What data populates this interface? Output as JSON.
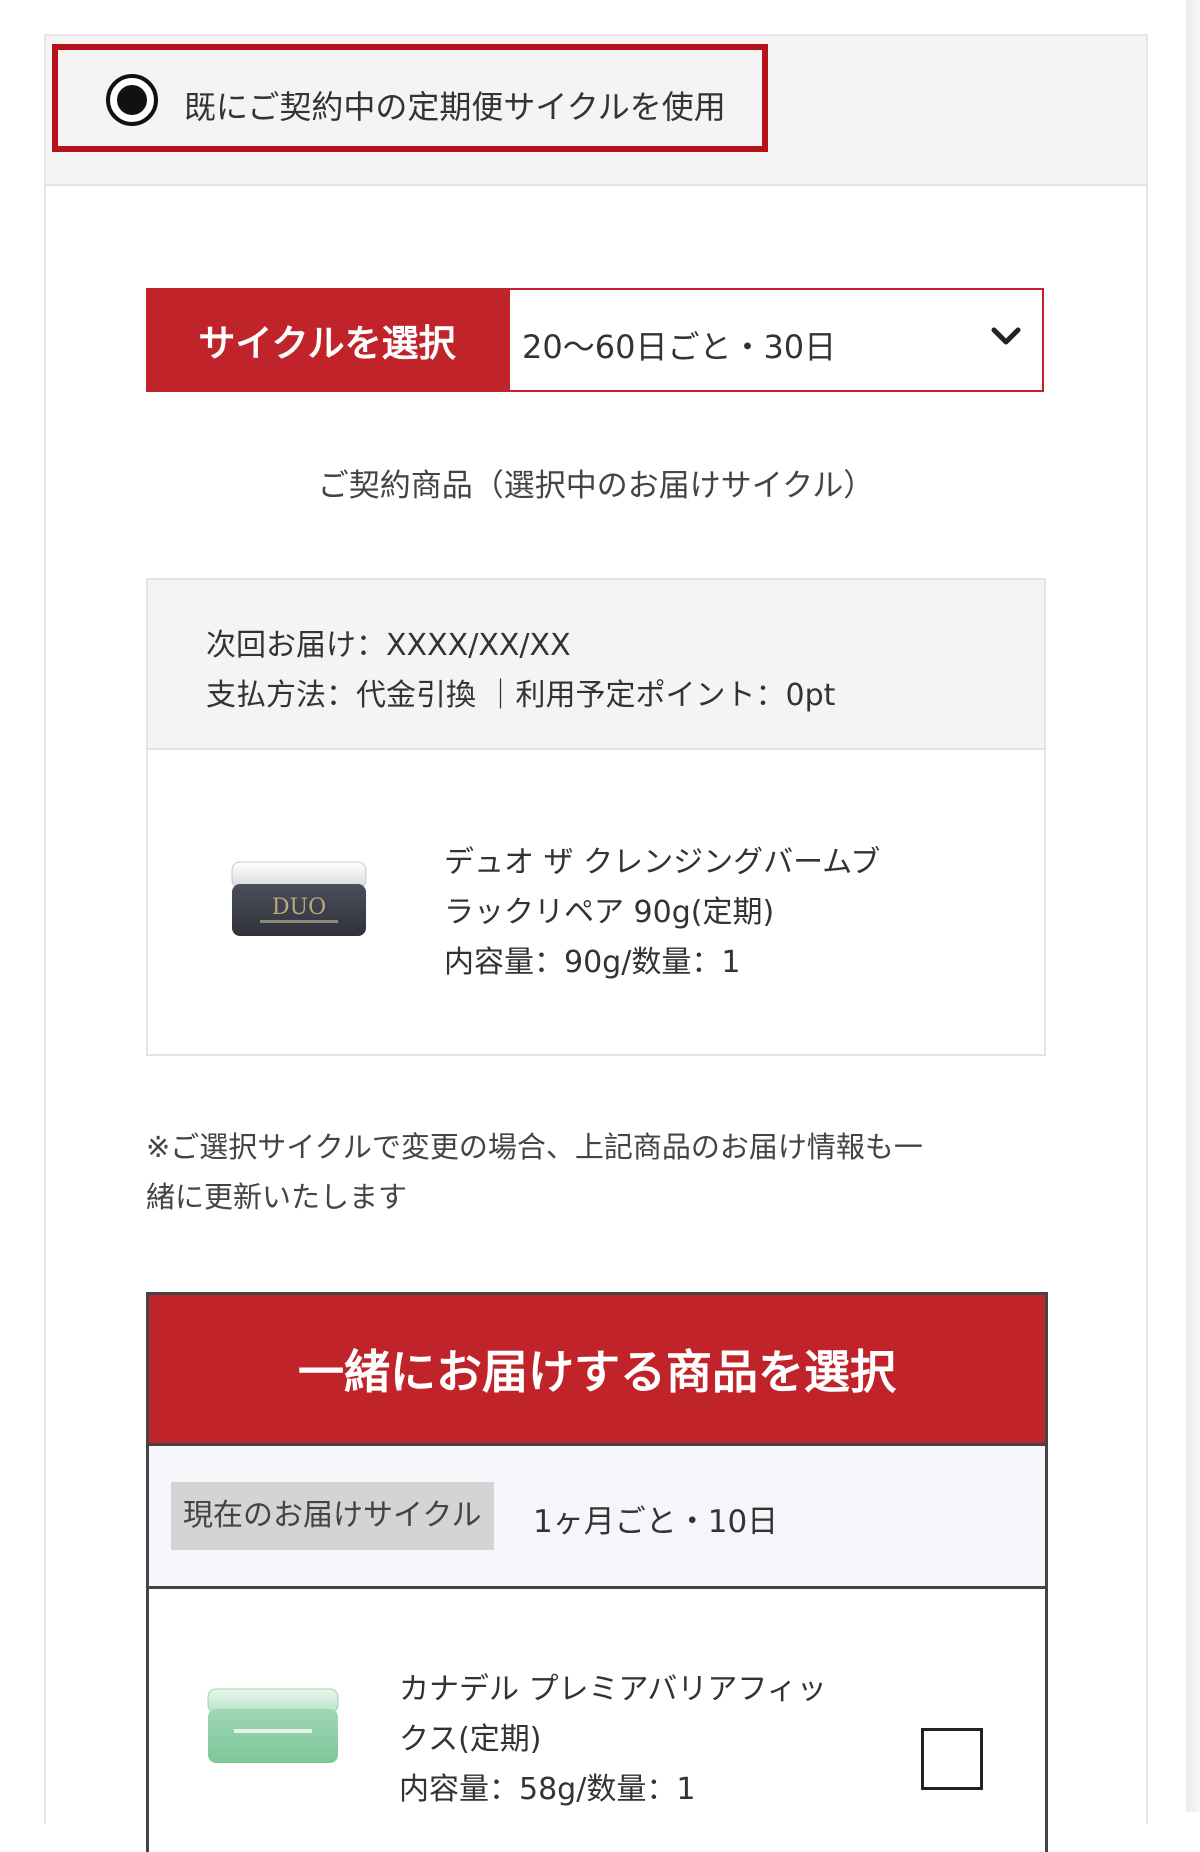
{
  "radio_option": {
    "label": "既にご契約中の定期便サイクルを使用",
    "selected": true
  },
  "cycle": {
    "label": "サイクルを選択",
    "selected_value": "20〜60日ごと・30日"
  },
  "contract": {
    "title": "ご契約商品（選択中のお届けサイクル）",
    "next_delivery": "次回お届け：XXXX/XX/XX",
    "payment": "支払方法：代金引換 ｜利用予定ポイント：0pt",
    "product": {
      "name_line1": "デュオ ザ クレンジングバームブ",
      "name_line2": "ラックリペア 90g(定期)",
      "quantity": "内容量：90g/数量：1",
      "image_icon": "duo-balm-jar-image"
    }
  },
  "notice": {
    "line1": "※ご選択サイクルで変更の場合、上記商品のお届け情報も一",
    "line2": "緒に更新いたします"
  },
  "bundle": {
    "header": "一緒にお届けする商品を選択",
    "current_cycle_label": "現在のお届けサイクル",
    "current_cycle_value": "1ヶ月ごと・10日",
    "items": [
      {
        "name_line1": "カナデル プレミアバリアフィッ",
        "name_line2": "クス(定期)",
        "quantity": "内容量：58g/数量：1",
        "checked": false,
        "image_icon": "canadel-jar-image"
      }
    ]
  },
  "colors": {
    "accent_red": "#c1232a",
    "highlight_frame": "#b5121b",
    "panel_gray": "#f4f4f4"
  }
}
